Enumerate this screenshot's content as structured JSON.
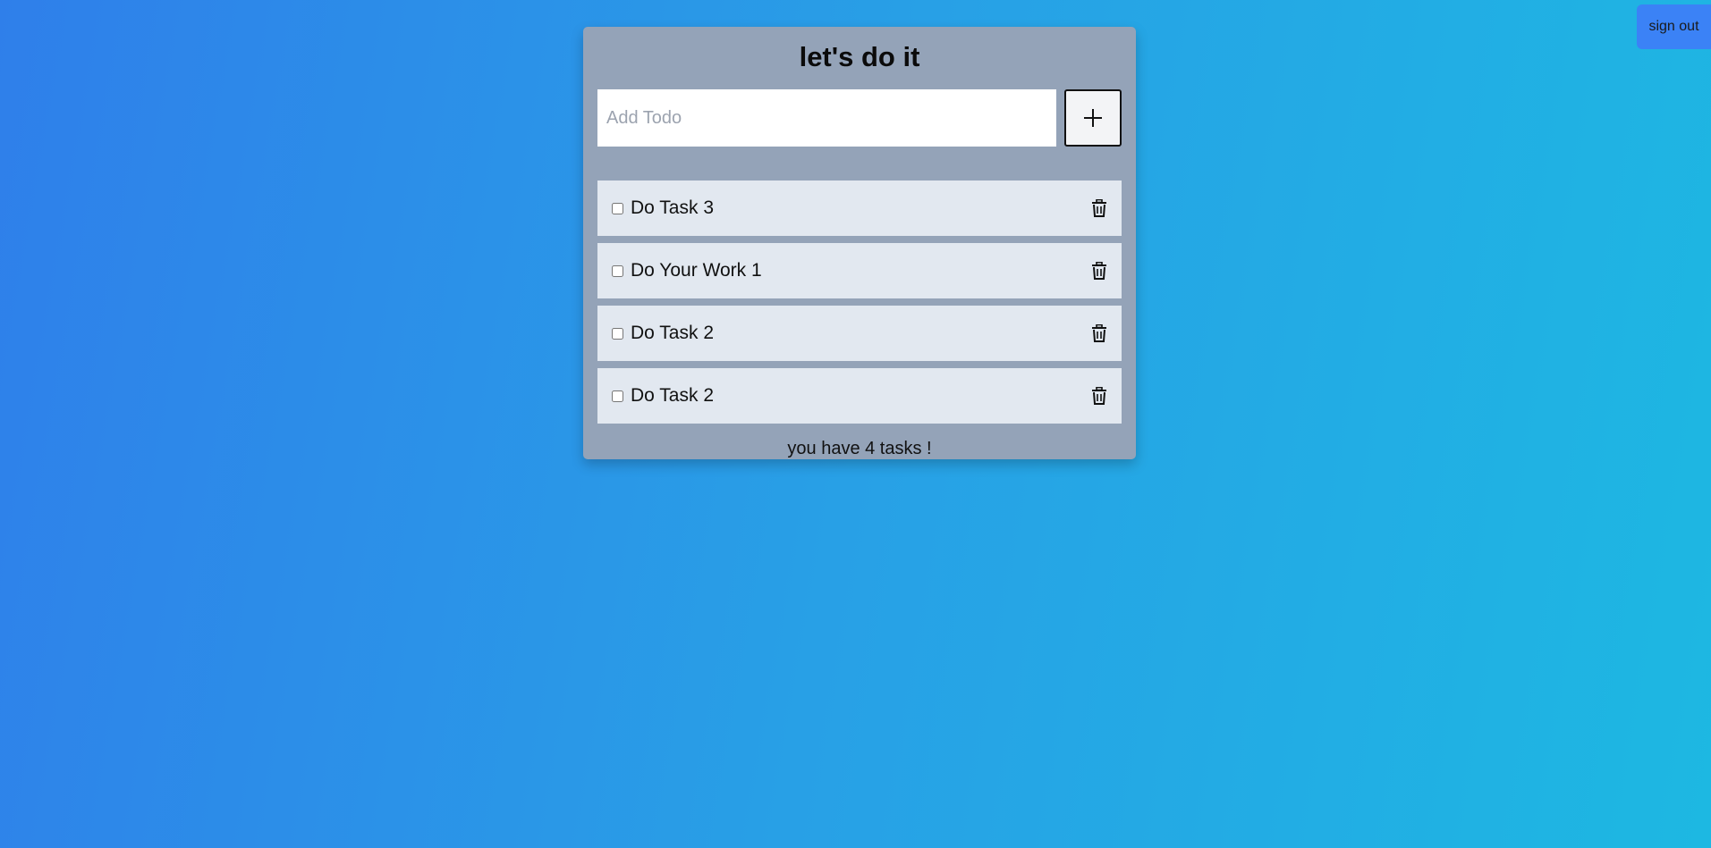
{
  "header": {
    "signout_label": "sign out"
  },
  "app": {
    "title": "let's do it",
    "add_input": {
      "placeholder": "Add Todo",
      "value": ""
    },
    "add_button_icon": "plus-icon",
    "todos": [
      {
        "label": "Do Task 3",
        "done": false
      },
      {
        "label": "Do Your Work 1",
        "done": false
      },
      {
        "label": "Do Task 2",
        "done": false
      },
      {
        "label": "Do Task 2",
        "done": false
      }
    ],
    "delete_icon": "trash-icon",
    "summary": "you have 4 tasks !"
  },
  "colors": {
    "background_start": "#2f7fea",
    "background_end": "#1db8e2",
    "card": "#94a3b8",
    "item": "#e2e8f0",
    "signout": "#3b82f6"
  }
}
